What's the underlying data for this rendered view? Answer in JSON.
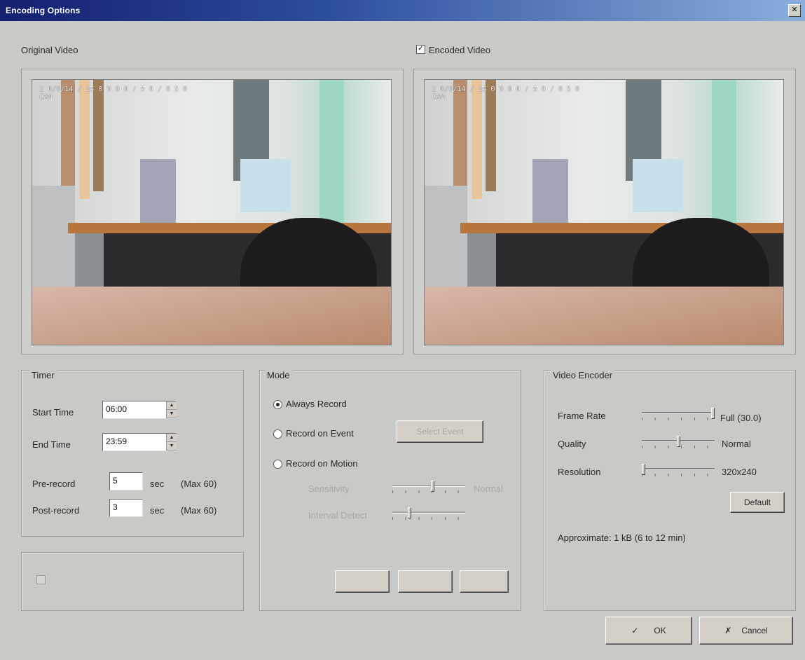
{
  "window": {
    "title": "Encoding Options",
    "close_glyph": "✕"
  },
  "original_video": {
    "label": "Original Video",
    "osd_line1": "2 0/6/14 / 15  0 9 0 0 / 5 0 / 0 5 0",
    "osd_line2": "CAM"
  },
  "encoded_video": {
    "label": "Encoded Video",
    "checked": true,
    "osd_line1": "2 0/6/14 / 15  0 9 0 0 / 5 0 / 0 5 0",
    "osd_line2": "CAM"
  },
  "timer": {
    "title": "Timer",
    "start_label": "Start Time",
    "start_value": "06:00",
    "end_label": "End Time",
    "end_value": "23:59",
    "pre_label": "Pre-record",
    "pre_value": "5",
    "pre_unit": "sec",
    "pre_max": "(Max 60)",
    "post_label": "Post-record",
    "post_value": "3",
    "post_unit": "sec",
    "post_max": "(Max 60)"
  },
  "mode": {
    "title": "Mode",
    "always_label": "Always Record",
    "event_label": "Record on Event",
    "event_button": "Select Event",
    "motion_label": "Record on Motion",
    "sensitivity_label": "Sensitivity",
    "sensitivity_value": "Normal",
    "interval_label": "Interval Detect",
    "bottom_text": "",
    "btn1": "",
    "btn2": "",
    "btn3": ""
  },
  "left_group": {
    "title": "",
    "checkbox_label": ""
  },
  "encoder": {
    "title": "Video Encoder",
    "frame_label": "Frame Rate",
    "frame_value": "Full (30.0)",
    "frame_level": 1.0,
    "quality_label": "Quality",
    "quality_value": "Normal",
    "quality_level": 0.5,
    "resolution_label": "Resolution",
    "resolution_value": "320x240",
    "resolution_level": 0.0,
    "default_button": "Default",
    "approx_text": "Approximate: 1 kB (6 to 12 min)"
  },
  "footer": {
    "ok_label": "OK",
    "ok_icon": "✓",
    "cancel_label": "Cancel",
    "cancel_icon": "✗"
  }
}
